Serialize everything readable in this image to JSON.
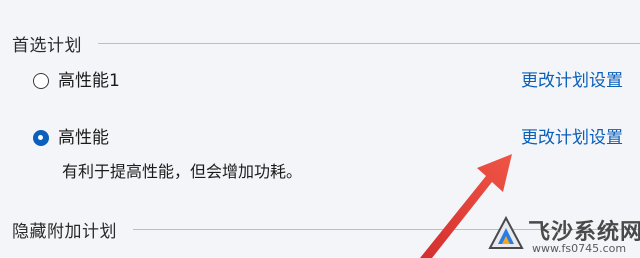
{
  "sections": {
    "preferred": {
      "title": "首选计划"
    },
    "hidden": {
      "title": "隐藏附加计划"
    }
  },
  "plans": [
    {
      "name": "高性能1",
      "selected": false,
      "link": "更改计划设置"
    },
    {
      "name": "高性能",
      "selected": true,
      "link": "更改计划设置",
      "description": "有利于提高性能，但会增加功耗。"
    }
  ],
  "watermark": {
    "text": "飞沙系统网",
    "url": "www.fs0745.com"
  },
  "colors": {
    "accent": "#0b5fbd",
    "link": "#0b5fb8",
    "annotation_arrow": "#e53935"
  }
}
